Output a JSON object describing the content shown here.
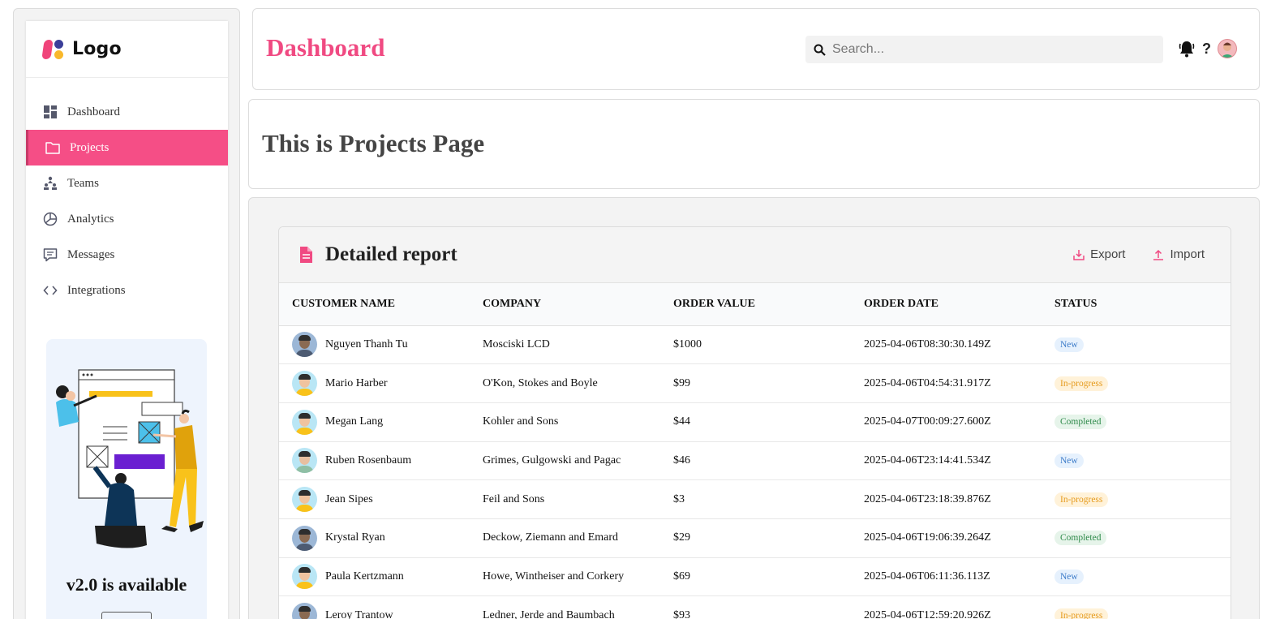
{
  "sidebar": {
    "logo_text": "Logo",
    "items": [
      {
        "label": "Dashboard",
        "icon": "dashboard-icon",
        "active": false
      },
      {
        "label": "Projects",
        "icon": "folder-icon",
        "active": true
      },
      {
        "label": "Teams",
        "icon": "teams-icon",
        "active": false
      },
      {
        "label": "Analytics",
        "icon": "pie-chart-icon",
        "active": false
      },
      {
        "label": "Messages",
        "icon": "message-icon",
        "active": false
      },
      {
        "label": "Integrations",
        "icon": "code-icon",
        "active": false
      }
    ],
    "promo": {
      "title": "v2.0 is available"
    }
  },
  "header": {
    "title": "Dashboard",
    "search_placeholder": "Search...",
    "help_label": "?"
  },
  "banner": {
    "title": "This is Projects Page"
  },
  "report": {
    "title": "Detailed report",
    "export_label": "Export",
    "import_label": "Import",
    "columns": [
      "Customer Name",
      "Company",
      "Order Value",
      "Order Date",
      "Status"
    ],
    "rows": [
      {
        "name": "Nguyen Thanh Tu",
        "company": "Mosciski LCD",
        "value": "$1000",
        "date": "2025-04-06T08:30:30.149Z",
        "status": "New"
      },
      {
        "name": "Mario Harber",
        "company": "O'Kon, Stokes and Boyle",
        "value": "$99",
        "date": "2025-04-06T04:54:31.917Z",
        "status": "In-progress"
      },
      {
        "name": "Megan Lang",
        "company": "Kohler and Sons",
        "value": "$44",
        "date": "2025-04-07T00:09:27.600Z",
        "status": "Completed"
      },
      {
        "name": "Ruben Rosenbaum",
        "company": "Grimes, Gulgowski and Pagac",
        "value": "$46",
        "date": "2025-04-06T23:14:41.534Z",
        "status": "New"
      },
      {
        "name": "Jean Sipes",
        "company": "Feil and Sons",
        "value": "$3",
        "date": "2025-04-06T23:18:39.876Z",
        "status": "In-progress"
      },
      {
        "name": "Krystal Ryan",
        "company": "Deckow, Ziemann and Emard",
        "value": "$29",
        "date": "2025-04-06T19:06:39.264Z",
        "status": "Completed"
      },
      {
        "name": "Paula Kertzmann",
        "company": "Howe, Wintheiser and Corkery",
        "value": "$69",
        "date": "2025-04-06T06:11:36.113Z",
        "status": "New"
      },
      {
        "name": "Leroy Trantow",
        "company": "Ledner, Jerde and Baumbach",
        "value": "$93",
        "date": "2025-04-06T12:59:20.926Z",
        "status": "In-progress"
      }
    ]
  },
  "colors": {
    "accent": "#f54e86",
    "title_pink": "#f04a82"
  }
}
